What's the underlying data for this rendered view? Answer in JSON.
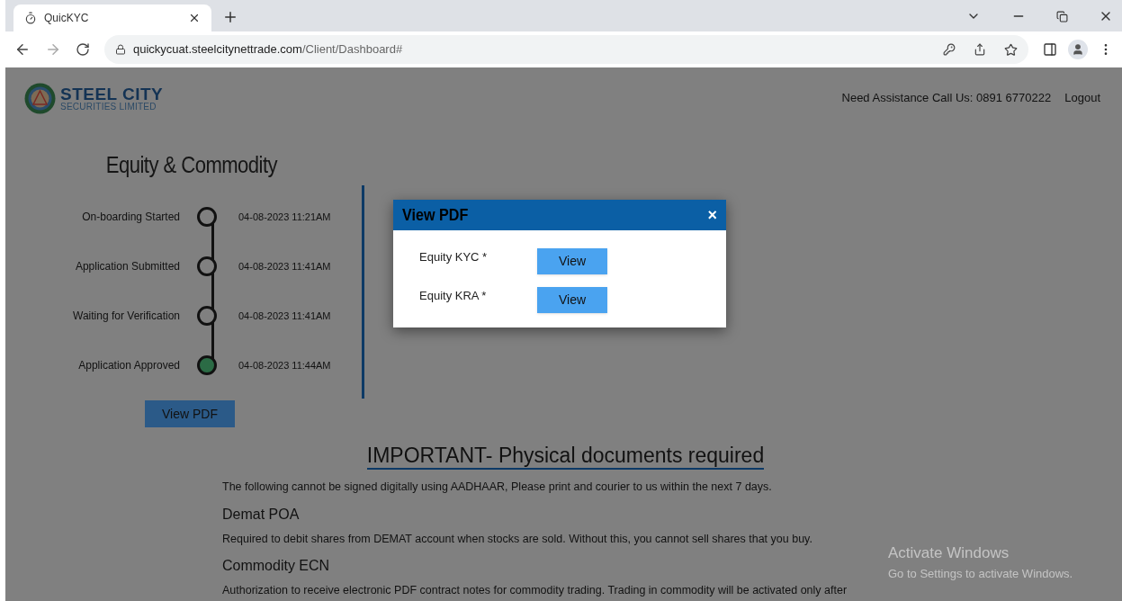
{
  "browser": {
    "tab": {
      "title": "QuicKYC"
    },
    "url": {
      "host": "quickycuat.steelcitynettrade.com",
      "path": "/Client/Dashboard#"
    }
  },
  "header": {
    "logo": {
      "name": "STEEL CITY",
      "subtitle": "SECURITIES LIMITED"
    },
    "assistance": "Need Assistance Call Us: 0891 6770222",
    "logout": "Logout"
  },
  "progress": {
    "title": "Equity & Commodity",
    "steps": [
      {
        "label": "On-boarding Started",
        "time": "04-08-2023 11:21AM",
        "completed": false
      },
      {
        "label": "Application Submitted",
        "time": "04-08-2023 11:41AM",
        "completed": false
      },
      {
        "label": "Waiting for Verification",
        "time": "04-08-2023 11:41AM",
        "completed": false
      },
      {
        "label": "Application Approved",
        "time": "04-08-2023 11:44AM",
        "completed": true
      }
    ],
    "button": "View PDF"
  },
  "modal": {
    "title": "View PDF",
    "close": "×",
    "rows": [
      {
        "label": "Equity KYC *",
        "button": "View"
      },
      {
        "label": "Equity KRA *",
        "button": "View"
      }
    ]
  },
  "important": {
    "heading": "IMPORTANT- Physical documents required",
    "intro": "The following cannot be signed digitally using AADHAAR, Please print and courier to us within the next 7 days.",
    "sections": [
      {
        "heading": "Demat POA",
        "text": "Required to debit shares from DEMAT account when stocks are sold. Without this, you cannot sell shares that you buy."
      },
      {
        "heading": "Commodity ECN",
        "text": "Authorization to receive electronic PDF contract notes for commodity trading. Trading in commodity will be activated only after"
      }
    ]
  },
  "os_notice": {
    "title": "Activate Windows",
    "subtitle": "Go to Settings to activate Windows."
  }
}
